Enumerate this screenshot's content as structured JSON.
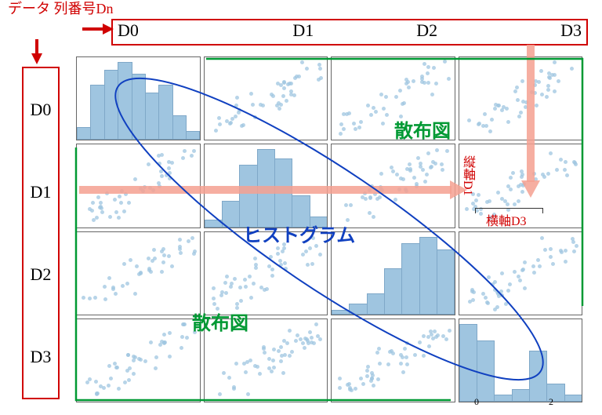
{
  "top_label_text": "データ\n列番号Dn",
  "top_arrow_icon": "arrow-right",
  "side_arrow_icon": "arrow-down",
  "columns": [
    "D0",
    "D1",
    "D2",
    "D3"
  ],
  "rows": [
    "D0",
    "D1",
    "D2",
    "D3"
  ],
  "annotations": {
    "scatter_upper": "散布図",
    "scatter_lower": "散布図",
    "histogram": "ヒストグラム",
    "y_axis_example": "縦軸D1",
    "x_axis_example": "横軸D3"
  },
  "xaxis_visible_ticks": [
    "0",
    "2"
  ],
  "chart_data": {
    "type": "pairplot",
    "description": "4×4 scatterplot matrix (pairplot) with histograms on the diagonal",
    "variables": [
      "D0",
      "D1",
      "D2",
      "D3"
    ],
    "diagonals": [
      {
        "var": "D0",
        "type": "histogram",
        "bins": [
          0,
          1,
          2,
          3,
          4,
          5,
          6,
          7,
          8
        ],
        "counts": [
          3,
          14,
          18,
          20,
          17,
          12,
          14,
          6,
          2
        ],
        "xlim": [
          0,
          8
        ]
      },
      {
        "var": "D1",
        "type": "histogram",
        "bins": [
          0,
          1,
          2,
          3,
          4,
          5,
          6
        ],
        "counts": [
          2,
          8,
          20,
          25,
          22,
          10,
          3
        ],
        "xlim": [
          0,
          6
        ]
      },
      {
        "var": "D2",
        "type": "histogram",
        "bins": [
          0,
          1,
          2,
          3,
          4,
          5,
          6
        ],
        "counts": [
          1,
          3,
          6,
          14,
          22,
          24,
          20
        ],
        "xlim": [
          0,
          6
        ]
      },
      {
        "var": "D3",
        "type": "histogram",
        "bins": [
          0,
          0.5,
          1,
          1.5,
          2,
          2.5,
          3
        ],
        "counts": [
          28,
          22,
          2,
          4,
          18,
          6,
          2
        ],
        "xlim": [
          0,
          3
        ]
      }
    ],
    "offdiagonals": {
      "type": "scatter",
      "correlation": "positive",
      "points_per_panel_approx": 90
    },
    "overlays": [
      {
        "shape": "ellipse",
        "around": "diagonal",
        "label": "ヒストグラム",
        "color": "#1040c0"
      },
      {
        "shape": "triangle",
        "region": "upper",
        "label": "散布図",
        "color": "#009933"
      },
      {
        "shape": "triangle",
        "region": "lower",
        "label": "散布図",
        "color": "#009933"
      },
      {
        "shape": "arrow",
        "from_row": "D1",
        "direction": "right",
        "label": "縦軸D1",
        "color": "#f4a090"
      },
      {
        "shape": "arrow",
        "from_col": "D3",
        "direction": "down",
        "label": "横軸D3",
        "color": "#f4a090"
      }
    ]
  }
}
